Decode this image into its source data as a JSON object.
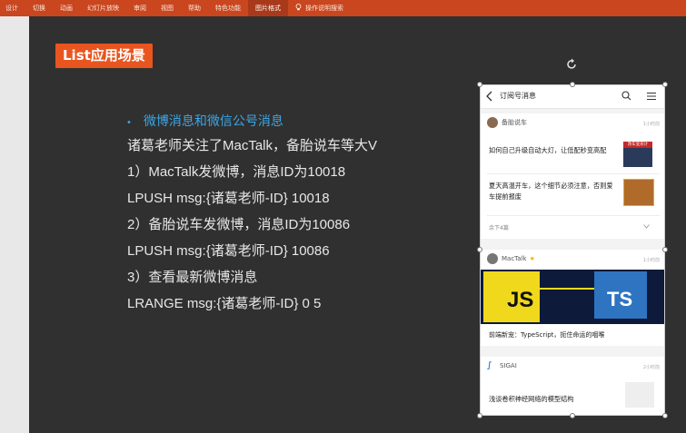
{
  "ribbon": {
    "tabs": [
      "设计",
      "切换",
      "动画",
      "幻灯片放映",
      "审阅",
      "视图",
      "帮助",
      "特色功能",
      "图片格式"
    ],
    "search_label": "操作说明搜索"
  },
  "slide": {
    "title": "List应用场景",
    "bullet": "微博消息和微信公号消息",
    "lines": [
      "诸葛老师关注了MacTalk，备胎说车等大V",
      "1）MacTalk发微博，消息ID为10018",
      "LPUSH  msg:{诸葛老师-ID}  10018",
      "2）备胎说车发微博，消息ID为10086",
      "LPUSH  msg:{诸葛老师-ID} 10086",
      "3）查看最新微博消息",
      "LRANGE  msg:{诸葛老师-ID}  0  5"
    ]
  },
  "phone": {
    "header_title": "订阅号消息",
    "card1": {
      "account": "备胎说车",
      "time": "1小时前",
      "item1": "如何自己升级自动大灯，让低配秒变高配",
      "item1_thumb_label": "改车变形计",
      "item2": "夏天高温开车，这个细节必须注意，否则爱车提前报废",
      "more": "余下4篇"
    },
    "card2": {
      "account": "MacTalk",
      "time": "1小时前",
      "banner_js": "JS",
      "banner_ts": "TS",
      "caption": "前端新宠：TypeScript，扼住命运的咽喉"
    },
    "card3": {
      "account": "SIGAI",
      "time": "2小时前",
      "item": "浅谈卷积神经网络的模型结构"
    }
  }
}
